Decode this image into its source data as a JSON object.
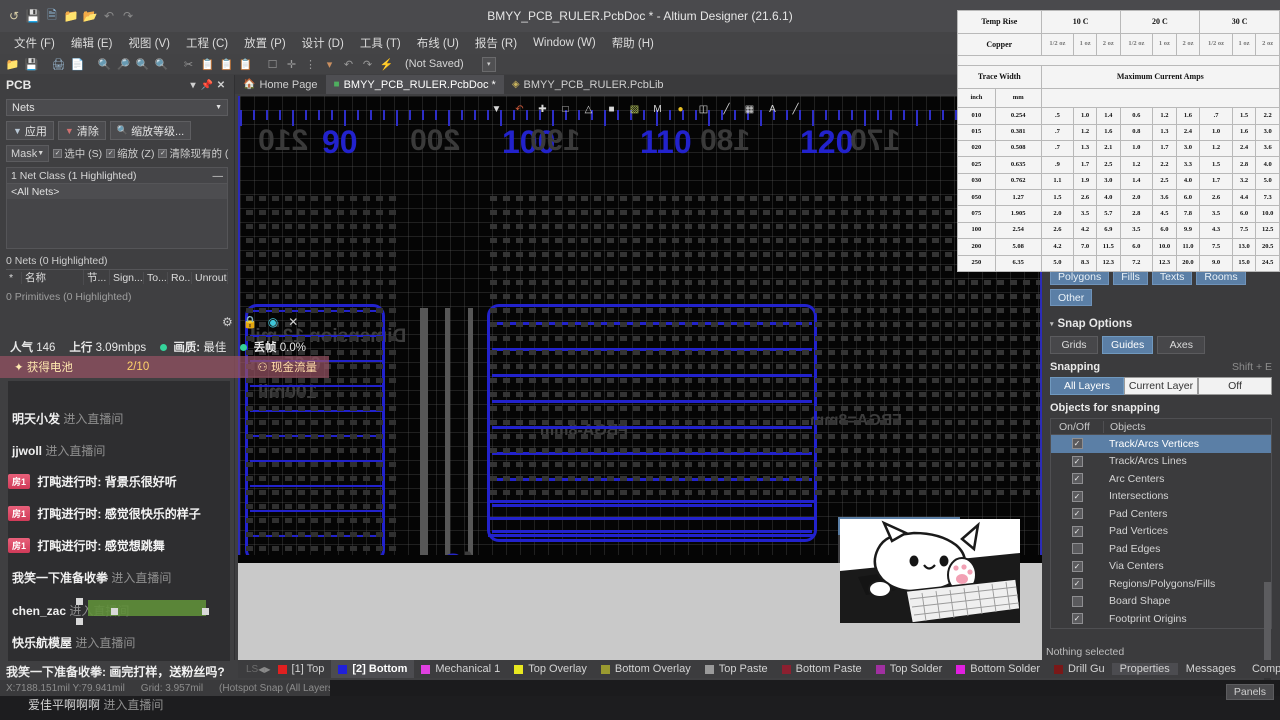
{
  "window": {
    "title": "BMYY_PCB_RULER.PcbDoc * - Altium Designer (21.6.1)",
    "quick_access_icons": [
      "altium-logo-icon",
      "save-icon",
      "save-all-icon",
      "open-folder-icon",
      "open-project-icon",
      "undo-icon",
      "redo-icon"
    ]
  },
  "menubar": [
    {
      "label": "文件 (F)"
    },
    {
      "label": "编辑 (E)"
    },
    {
      "label": "视图 (V)"
    },
    {
      "label": "工程 (C)"
    },
    {
      "label": "放置 (P)"
    },
    {
      "label": "设计 (D)"
    },
    {
      "label": "工具 (T)"
    },
    {
      "label": "布线 (U)"
    },
    {
      "label": "报告 (R)"
    },
    {
      "label": "Window (W)"
    },
    {
      "label": "帮助 (H)"
    }
  ],
  "toolbar": {
    "not_saved": "(Not Saved)"
  },
  "doc_tabs": [
    {
      "label": "Home Page",
      "icon": "home-icon",
      "selected": false
    },
    {
      "label": "BMYY_PCB_RULER.PcbDoc *",
      "icon": "pcb-doc-icon",
      "selected": true
    },
    {
      "label": "BMYY_PCB_RULER.PcbLib",
      "icon": "pcb-lib-icon",
      "selected": false
    }
  ],
  "pcb_panel": {
    "title": "PCB",
    "controls": [
      "chevron-down-icon",
      "pin-icon",
      "close-icon"
    ],
    "scope_dropdown": "Nets",
    "buttons": [
      {
        "label": "应用",
        "icon": "filter-icon"
      },
      {
        "label": "清除",
        "icon": "clear-filter-icon"
      },
      {
        "label": "缩放等级...",
        "icon": "magnifier-icon"
      }
    ],
    "mask_select": "Mask",
    "checkboxes": [
      {
        "label": "选中 (S)",
        "checked": true
      },
      {
        "label": "缩放 (Z)",
        "checked": true
      },
      {
        "label": "清除现有的 (",
        "checked": true
      }
    ],
    "netclass_header": "1 Net Class (1 Highlighted)",
    "netclass_rows": [
      "<All Nets>"
    ],
    "nets_header": "0 Nets (0 Highlighted)",
    "net_columns": [
      "*",
      "名称",
      "节...",
      "Sign...",
      "To...",
      "Ro...",
      "Unrout..."
    ],
    "primitives_header": "0 Primitives (0 Highlighted)"
  },
  "canvas": {
    "toolbar_icons": [
      "filter-icon",
      "interactive-route-icon",
      "crosshair-icon",
      "place-rect-icon",
      "place-polygon-icon",
      "place-fill-icon",
      "place-region-icon",
      "measure-icon",
      "place-via-icon",
      "place-3d-body-icon",
      "place-dimension-icon",
      "place-table-icon",
      "place-text-icon",
      "place-line-icon"
    ],
    "ruler_labels_blue": [
      "90",
      "100",
      "110",
      "120"
    ],
    "ruler_labels_mirrored": [
      "210",
      "200",
      "190",
      "180",
      "170"
    ],
    "silkscreen_ghost_text": [
      "Dimension 12 mil",
      "0.65mm",
      "100mil",
      "FBGA=8mm",
      "FBGA-8mm"
    ],
    "snap_tooltip": {
      "items": [
        "c/Arcs Vertices",
        "c/Arcs Lines",
        "Centers"
      ],
      "selected_index": 0
    },
    "overlay_image": "bongo-cat-image"
  },
  "right_panel": {
    "object_chips": [
      "Polygons",
      "Fills",
      "Texts",
      "Rooms",
      "Other"
    ],
    "snap_options_title": "Snap Options",
    "snap_mode_buttons": [
      {
        "label": "Grids",
        "active": false
      },
      {
        "label": "Guides",
        "active": true
      },
      {
        "label": "Axes",
        "active": false
      }
    ],
    "snapping_label": "Snapping",
    "snapping_shortcut": "Shift + E",
    "snapping_segments": [
      {
        "label": "All Layers",
        "active": true
      },
      {
        "label": "Current Layer",
        "active": false
      },
      {
        "label": "Off",
        "active": false
      }
    ],
    "objects_for_snapping_label": "Objects for snapping",
    "table_headers": [
      "On/Off",
      "Objects"
    ],
    "snap_objects": [
      {
        "name": "Track/Arcs Vertices",
        "checked": true,
        "selected": true
      },
      {
        "name": "Track/Arcs Lines",
        "checked": true,
        "selected": false
      },
      {
        "name": "Arc Centers",
        "checked": true,
        "selected": false
      },
      {
        "name": "Intersections",
        "checked": true,
        "selected": false
      },
      {
        "name": "Pad Centers",
        "checked": true,
        "selected": false
      },
      {
        "name": "Pad Vertices",
        "checked": true,
        "selected": false
      },
      {
        "name": "Pad Edges",
        "checked": false,
        "selected": false
      },
      {
        "name": "Via Centers",
        "checked": true,
        "selected": false
      },
      {
        "name": "Regions/Polygons/Fills",
        "checked": true,
        "selected": false
      },
      {
        "name": "Board Shape",
        "checked": false,
        "selected": false
      },
      {
        "name": "Footprint Origins",
        "checked": true,
        "selected": false
      }
    ],
    "nothing_selected": "Nothing selected"
  },
  "trace_width_table": {
    "temp_rise_label": "Temp Rise",
    "copper_label": "Copper",
    "trace_width_label": "Trace Width",
    "max_current_label": "Maximum Current Amps",
    "temp_rises": [
      "10 C",
      "20 C",
      "30 C"
    ],
    "copper_weights": [
      "1/2 oz",
      "1 oz",
      "2 oz"
    ],
    "unit_headers": [
      "inch",
      "mm"
    ],
    "rows": [
      {
        "inch": "010",
        "mm": "0.254",
        "amps": [
          ".5",
          "1.0",
          "1.4",
          "0.6",
          "1.2",
          "1.6",
          ".7",
          "1.5",
          "2.2"
        ]
      },
      {
        "inch": "015",
        "mm": "0.381",
        "amps": [
          ".7",
          "1.2",
          "1.6",
          "0.8",
          "1.3",
          "2.4",
          "1.0",
          "1.6",
          "3.0"
        ]
      },
      {
        "inch": "020",
        "mm": "0.508",
        "amps": [
          ".7",
          "1.3",
          "2.1",
          "1.0",
          "1.7",
          "3.0",
          "1.2",
          "2.4",
          "3.6"
        ]
      },
      {
        "inch": "025",
        "mm": "0.635",
        "amps": [
          ".9",
          "1.7",
          "2.5",
          "1.2",
          "2.2",
          "3.3",
          "1.5",
          "2.8",
          "4.0"
        ]
      },
      {
        "inch": "030",
        "mm": "0.762",
        "amps": [
          "1.1",
          "1.9",
          "3.0",
          "1.4",
          "2.5",
          "4.0",
          "1.7",
          "3.2",
          "5.0"
        ]
      },
      {
        "inch": "050",
        "mm": "1.27",
        "amps": [
          "1.5",
          "2.6",
          "4.0",
          "2.0",
          "3.6",
          "6.0",
          "2.6",
          "4.4",
          "7.3"
        ]
      },
      {
        "inch": "075",
        "mm": "1.905",
        "amps": [
          "2.0",
          "3.5",
          "5.7",
          "2.8",
          "4.5",
          "7.8",
          "3.5",
          "6.0",
          "10.0"
        ]
      },
      {
        "inch": "100",
        "mm": "2.54",
        "amps": [
          "2.6",
          "4.2",
          "6.9",
          "3.5",
          "6.0",
          "9.9",
          "4.3",
          "7.5",
          "12.5"
        ]
      },
      {
        "inch": "200",
        "mm": "5.08",
        "amps": [
          "4.2",
          "7.0",
          "11.5",
          "6.0",
          "10.0",
          "11.0",
          "7.5",
          "13.0",
          "20.5"
        ]
      },
      {
        "inch": "250",
        "mm": "6.35",
        "amps": [
          "5.0",
          "8.3",
          "12.3",
          "7.2",
          "12.3",
          "20.0",
          "9.0",
          "15.0",
          "24.5"
        ]
      }
    ]
  },
  "stream_overlay": {
    "toolbar_icons": [
      "gear-icon",
      "lock-icon",
      "camera-icon",
      "close-icon"
    ],
    "stats": [
      {
        "label": "人气",
        "value": "146"
      },
      {
        "label": "上行",
        "value": "3.09mbps"
      },
      {
        "label": "画质:",
        "value": "最佳"
      },
      {
        "label": "丢帧",
        "value": "0.0%"
      }
    ],
    "task": {
      "left": "获得电池",
      "progress": "2/10",
      "right": "现金流量",
      "star_icon": "star-icon",
      "coin_icon": "coin-icon"
    },
    "chat": [
      {
        "user": "明天小发",
        "action": "进入直播间",
        "type": "join"
      },
      {
        "user": "jjwoll",
        "action": "进入直播间",
        "type": "join"
      },
      {
        "badge": "房1",
        "user": "打盹进行时",
        "message": "背景乐很好听",
        "type": "msg"
      },
      {
        "badge": "房1",
        "user": "打盹进行时",
        "message": "感觉很快乐的样子",
        "type": "msg"
      },
      {
        "badge": "房1",
        "user": "打盹进行时",
        "message": "感觉想跳舞",
        "type": "msg"
      },
      {
        "user": "我笑一下准备收拳",
        "action": "进入直播间",
        "type": "join"
      },
      {
        "user": "chen_zac",
        "action": "进入直播间",
        "type": "join"
      },
      {
        "user": "快乐航模屋",
        "action": "进入直播间",
        "type": "join"
      }
    ],
    "bottom_msg": {
      "user": "我笑一下准备收拳:",
      "message": "画完打样，送粉丝吗?"
    },
    "bottom_msg2": {
      "user": "爱佳平啊啊啊",
      "action": "进入直播间"
    }
  },
  "layer_bar": {
    "ls_label": "LS",
    "layers": [
      {
        "label": "[1] Top",
        "color": "#e02020",
        "selected": false
      },
      {
        "label": "[2] Bottom",
        "color": "#2020d8",
        "selected": true
      },
      {
        "label": "Mechanical 1",
        "color": "#e040e0",
        "selected": false
      },
      {
        "label": "Top Overlay",
        "color": "#e8e820",
        "selected": false
      },
      {
        "label": "Bottom Overlay",
        "color": "#9a9a30",
        "selected": false
      },
      {
        "label": "Top Paste",
        "color": "#9a9a9a",
        "selected": false
      },
      {
        "label": "Bottom Paste",
        "color": "#8c2030",
        "selected": false
      },
      {
        "label": "Top Solder",
        "color": "#a030a0",
        "selected": false
      },
      {
        "label": "Bottom Solder",
        "color": "#e020e0",
        "selected": false
      },
      {
        "label": "Drill Gu",
        "color": "#7a1818",
        "selected": false
      }
    ],
    "panel_buttons": [
      {
        "label": "Properties",
        "selected": true
      },
      {
        "label": "Messages",
        "selected": false
      },
      {
        "label": "Components",
        "selected": false
      }
    ]
  },
  "status_bar": {
    "coords": "X:7188.151mil Y:79.941mil",
    "grid": "Grid: 3.957mil",
    "hint": "(Hotspot Snap (All Layers)) [Th",
    "panels_button": "Panels"
  },
  "colors": {
    "accent_blue": "#5b7fa6",
    "trace_blue": "#2222cc",
    "panel_bg": "#3f3f41",
    "canvas_bg": "#050505"
  }
}
